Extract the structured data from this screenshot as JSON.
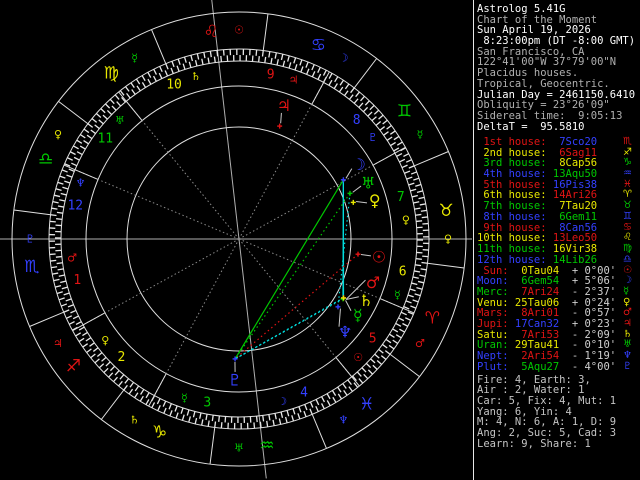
{
  "palette": {
    "red": "#e01414",
    "yellow": "#e8e800",
    "green": "#00c800",
    "blue": "#3340ff",
    "cyan": "#00dcdc",
    "white": "#ffffff",
    "gray": "#b0b0b0",
    "dim": "#8a8a8a",
    "ring": "#e0e0e0",
    "pointer": "#c8c8c8",
    "bg": "#000000"
  },
  "sidebar": {
    "header_lines": [
      {
        "text": "Astrolog 5.41G",
        "bright": true
      },
      {
        "text": "Chart of the Moment",
        "bright": false
      },
      {
        "text": "Sun April 19, 2026",
        "bright": true
      },
      {
        "text": " 8:23:00pm (DT -8:00 GMT)",
        "bright": true
      },
      {
        "text": "San Francisco, CA",
        "bright": false
      },
      {
        "text": "122°41'00\"W 37°79'00\"N",
        "bright": false
      },
      {
        "text": "Placidus houses.",
        "bright": false
      },
      {
        "text": "Tropical, Geocentric.",
        "bright": false
      },
      {
        "text": "Julian Day = 2461150.6410",
        "bright": true
      },
      {
        "text": "Obliquity = 23°26'09\"",
        "bright": false
      },
      {
        "text": "Sidereal time:  9:05:13",
        "bright": false
      },
      {
        "text": "DeltaT =  95.5810",
        "bright": true
      }
    ],
    "houses": [
      {
        "label": " 1st house:",
        "value": "7Sco20",
        "label_color": "red",
        "value_color": "blue",
        "glyph": "♏"
      },
      {
        "label": " 2nd house:",
        "value": "6Sag11",
        "label_color": "yellow",
        "value_color": "red",
        "glyph": "♐"
      },
      {
        "label": " 3rd house:",
        "value": "8Cap56",
        "label_color": "green",
        "value_color": "yellow",
        "glyph": "♑"
      },
      {
        "label": " 4th house:",
        "value": "13Aqu50",
        "label_color": "blue",
        "value_color": "green",
        "glyph": "♒"
      },
      {
        "label": " 5th house:",
        "value": "16Pis38",
        "label_color": "red",
        "value_color": "blue",
        "glyph": "♓"
      },
      {
        "label": " 6th house:",
        "value": "14Ari26",
        "label_color": "yellow",
        "value_color": "red",
        "glyph": "♈"
      },
      {
        "label": " 7th house:",
        "value": "7Tau20",
        "label_color": "green",
        "value_color": "yellow",
        "glyph": "♉"
      },
      {
        "label": " 8th house:",
        "value": "6Gem11",
        "label_color": "blue",
        "value_color": "green",
        "glyph": "♊"
      },
      {
        "label": " 9th house:",
        "value": "8Can56",
        "label_color": "red",
        "value_color": "blue",
        "glyph": "♋"
      },
      {
        "label": "10th house:",
        "value": "13Leo50",
        "label_color": "yellow",
        "value_color": "red",
        "glyph": "♌"
      },
      {
        "label": "11th house:",
        "value": "16Vir38",
        "label_color": "green",
        "value_color": "yellow",
        "glyph": "♍"
      },
      {
        "label": "12th house:",
        "value": "14Lib26",
        "label_color": "blue",
        "value_color": "green",
        "glyph": "♎"
      }
    ],
    "planets": [
      {
        "label": " Sun:",
        "value": "0Tau04",
        "dev": "+ 0°00'",
        "label_color": "red",
        "value_color": "yellow",
        "glyph": "☉"
      },
      {
        "label": "Moon:",
        "value": "6Gem54",
        "dev": "+ 5°06'",
        "label_color": "blue",
        "value_color": "green",
        "glyph": "☽"
      },
      {
        "label": "Merc:",
        "value": "7Ari24",
        "dev": "- 2°37'",
        "label_color": "green",
        "value_color": "red",
        "glyph": "☿"
      },
      {
        "label": "Venu:",
        "value": "25Tau06",
        "dev": "+ 0°24'",
        "label_color": "yellow",
        "value_color": "yellow",
        "glyph": "♀"
      },
      {
        "label": "Mars:",
        "value": "8Ari01",
        "dev": "- 0°57'",
        "label_color": "red",
        "value_color": "red",
        "glyph": "♂"
      },
      {
        "label": "Jupi:",
        "value": "17Can32",
        "dev": "+ 0°23'",
        "label_color": "red",
        "value_color": "blue",
        "glyph": "♃"
      },
      {
        "label": "Satu:",
        "value": "7Ari53",
        "dev": "- 2°09'",
        "label_color": "yellow",
        "value_color": "red",
        "glyph": "♄"
      },
      {
        "label": "Uran:",
        "value": "29Tau41",
        "dev": "- 0°10'",
        "label_color": "green",
        "value_color": "yellow",
        "glyph": "♅"
      },
      {
        "label": "Nept:",
        "value": "2Ari54",
        "dev": "- 1°19'",
        "label_color": "blue",
        "value_color": "red",
        "glyph": "♆"
      },
      {
        "label": "Plut:",
        "value": "5Aqu27",
        "dev": "- 4°00'",
        "label_color": "blue",
        "value_color": "green",
        "glyph": "♇"
      }
    ],
    "stats": [
      "Fire: 4, Earth: 3,",
      "Air : 2, Water: 1",
      "Car: 5, Fix: 4, Mut: 1",
      "Yang: 6, Yin: 4",
      "M: 4, N: 6, A: 1, D: 9",
      "Ang: 2, Suc: 5, Cad: 3",
      "Learn: 9, Share: 1"
    ]
  },
  "chart_data": {
    "type": "astrology-wheel",
    "title": "Astrolog 5.41G Chart of the Moment wheel",
    "ascendant_lon": 217.333,
    "element_cycle": [
      "red",
      "yellow",
      "green",
      "blue"
    ],
    "zodiac": {
      "glyphs": [
        "♈",
        "♉",
        "♊",
        "♋",
        "♌",
        "♍",
        "♎",
        "♏",
        "♐",
        "♑",
        "♒",
        "♓"
      ],
      "rulers": [
        {
          "glyph": "♂",
          "color": "red"
        },
        {
          "glyph": "♀",
          "color": "yellow"
        },
        {
          "glyph": "☿",
          "color": "green"
        },
        {
          "glyph": "☽",
          "color": "blue"
        },
        {
          "glyph": "☉",
          "color": "red"
        },
        {
          "glyph": "☿",
          "color": "green"
        },
        {
          "glyph": "♀",
          "color": "yellow"
        },
        {
          "glyph": "♇",
          "color": "blue"
        },
        {
          "glyph": "♃",
          "color": "red"
        },
        {
          "glyph": "♄",
          "color": "yellow"
        },
        {
          "glyph": "♅",
          "color": "green"
        },
        {
          "glyph": "♆",
          "color": "blue"
        }
      ]
    },
    "houses": {
      "cusps": [
        217.333,
        246.183,
        278.933,
        313.833,
        346.633,
        14.433,
        37.333,
        66.183,
        98.933,
        133.833,
        166.633,
        194.433
      ],
      "numbers": [
        "1",
        "2",
        "3",
        "4",
        "5",
        "6",
        "7",
        "8",
        "9",
        "10",
        "11",
        "12"
      ]
    },
    "planets": [
      {
        "name": "Sun",
        "glyph": "☉",
        "color": "red",
        "lon": 30.067,
        "fan": 0
      },
      {
        "name": "Moon",
        "glyph": "☽",
        "color": "blue",
        "lon": 66.9,
        "fan": 2.4
      },
      {
        "name": "Mercury",
        "glyph": "☿",
        "color": "green",
        "lon": 7.4,
        "fan": -2.7
      },
      {
        "name": "Venus",
        "glyph": "♀",
        "color": "yellow",
        "lon": 55.1,
        "fan": -2.0
      },
      {
        "name": "Mars",
        "glyph": "♂",
        "color": "red",
        "lon": 8.017,
        "fan": 11.3
      },
      {
        "name": "Jupiter",
        "glyph": "♃",
        "color": "red",
        "lon": 107.533,
        "fan": 1.2
      },
      {
        "name": "Saturn",
        "glyph": "♄",
        "color": "yellow",
        "lon": 7.883,
        "fan": 3.7
      },
      {
        "name": "Uranus",
        "glyph": "♅",
        "color": "green",
        "lon": 59.683,
        "fan": 1.1
      },
      {
        "name": "Neptune",
        "glyph": "♆",
        "color": "blue",
        "lon": 2.9,
        "fan": -6.8
      },
      {
        "name": "Pluto",
        "glyph": "♇",
        "color": "blue",
        "lon": 305.45,
        "fan": 0.2
      }
    ],
    "aspects": [
      {
        "p1": "Moon",
        "p2": "Pluto",
        "type": "trine",
        "color": "green",
        "style": "solid"
      },
      {
        "p1": "Moon",
        "p2": "Mercury",
        "type": "sextile",
        "color": "cyan",
        "style": "solid"
      },
      {
        "p1": "Moon",
        "p2": "Saturn",
        "type": "sextile",
        "color": "cyan",
        "style": "solid"
      },
      {
        "p1": "Sun",
        "p2": "Pluto",
        "type": "square",
        "color": "red",
        "style": "dotted"
      },
      {
        "p1": "Uranus",
        "p2": "Pluto",
        "type": "trine",
        "color": "green",
        "style": "dotted"
      },
      {
        "p1": "Uranus",
        "p2": "Neptune",
        "type": "sextile",
        "color": "cyan",
        "style": "dotted"
      },
      {
        "p1": "Mercury",
        "p2": "Pluto",
        "type": "sextile",
        "color": "cyan",
        "style": "dotted"
      },
      {
        "p1": "Saturn",
        "p2": "Pluto",
        "type": "sextile",
        "color": "cyan",
        "style": "dotted"
      },
      {
        "p1": "Mars",
        "p2": "Pluto",
        "type": "sextile",
        "color": "cyan",
        "style": "dotted"
      }
    ],
    "layout": {
      "center": [
        239,
        239
      ],
      "radii": {
        "outer": 227,
        "sign_inner": 190,
        "hash_inner": 178,
        "number_inner": 153,
        "innermost": 112,
        "sign_glyph": 209,
        "house_number": 167,
        "planet_glyph": 141,
        "planet_dot": 120
      },
      "ruler_offset_deg": 7.7
    }
  }
}
